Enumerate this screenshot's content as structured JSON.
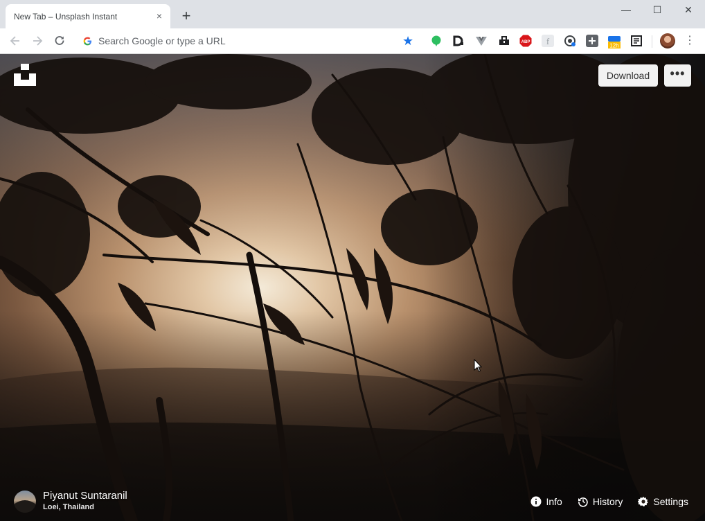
{
  "browser": {
    "tab": {
      "title": "New Tab – Unsplash Instant",
      "close_label": "×"
    },
    "new_tab_label": "+",
    "window_controls": {
      "minimize": "—",
      "maximize": "☐",
      "close": "✕"
    },
    "toolbar": {
      "back_icon": "back-arrow-icon",
      "forward_icon": "forward-arrow-icon",
      "reload_icon": "reload-icon",
      "omnibox_placeholder": "Search Google or type a URL",
      "star_glyph": "★",
      "badge_12h": "12h",
      "abp_text": "ABP",
      "menu_glyph": "⋮"
    },
    "colors": {
      "accent": "#1a73e8",
      "abp_red": "#d9161a",
      "evernote_green": "#2dbe60"
    }
  },
  "unsplash": {
    "download_label": "Download",
    "more_label": "•••",
    "photographer": "Piyanut Suntaranil",
    "location": "Loei, Thailand",
    "actions": [
      {
        "label": "Info",
        "icon": "info-icon"
      },
      {
        "label": "History",
        "icon": "history-icon"
      },
      {
        "label": "Settings",
        "icon": "gear-icon"
      }
    ]
  }
}
